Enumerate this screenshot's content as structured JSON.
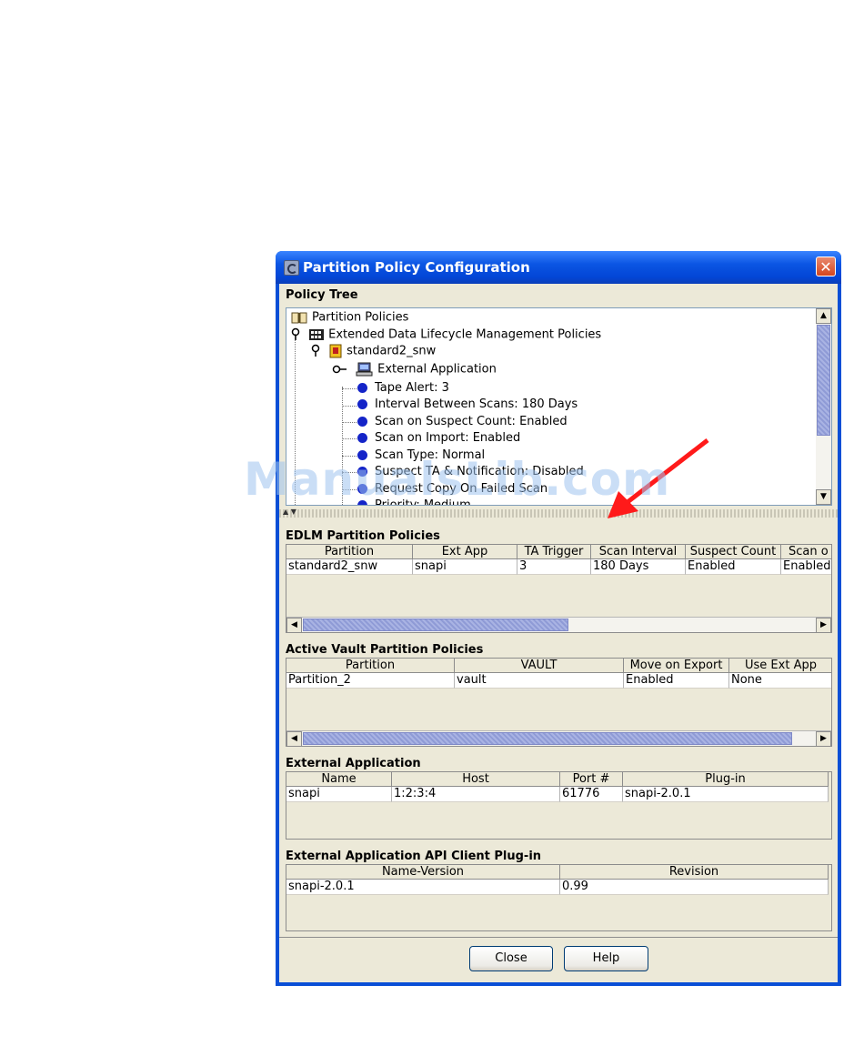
{
  "window": {
    "title": "Partition Policy Configuration",
    "close_glyph": "✕"
  },
  "policy_tree": {
    "label": "Policy Tree",
    "nodes": [
      {
        "text": "Partition Policies"
      },
      {
        "text": "Extended Data Lifecycle Management Policies"
      },
      {
        "text": "standard2_snw"
      },
      {
        "text": "External Application"
      },
      {
        "text": "Tape Alert: 3"
      },
      {
        "text": "Interval Between Scans: 180 Days"
      },
      {
        "text": "Scan on Suspect Count: Enabled"
      },
      {
        "text": "Scan on Import: Enabled"
      },
      {
        "text": "Scan Type: Normal"
      },
      {
        "text": "Suspect TA & Notification: Disabled"
      },
      {
        "text": "Request Copy On Failed Scan"
      },
      {
        "text": "Priority: Medium"
      }
    ]
  },
  "edlm": {
    "label": "EDLM Partition Policies",
    "columns": [
      "Partition",
      "Ext App",
      "TA Trigger",
      "Scan Interval",
      "Suspect Count",
      "Scan o"
    ],
    "rows": [
      [
        "standard2_snw",
        "snapi",
        "3",
        "180 Days",
        "Enabled",
        "Enabled"
      ]
    ]
  },
  "active_vault": {
    "label": "Active Vault Partition Policies",
    "columns": [
      "Partition",
      "VAULT",
      "Move on Export",
      "Use Ext App"
    ],
    "rows": [
      [
        "Partition_2",
        "vault",
        "Enabled",
        "None"
      ]
    ]
  },
  "external_app": {
    "label": "External Application",
    "columns": [
      "Name",
      "Host",
      "Port #",
      "Plug-in"
    ],
    "rows": [
      [
        "snapi",
        "1:2:3:4",
        "61776",
        "snapi-2.0.1"
      ]
    ]
  },
  "api_plugin": {
    "label": "External Application API Client Plug-in",
    "columns": [
      "Name-Version",
      "Revision"
    ],
    "rows": [
      [
        "snapi-2.0.1",
        "0.99"
      ]
    ]
  },
  "buttons": {
    "close": "Close",
    "help": "Help"
  },
  "watermark": "ManualsLib.com",
  "colors": {
    "titlebar": "#0b55e3",
    "annotation_arrow": "#ff1a1a",
    "tree_bullet": "#1424c8"
  }
}
